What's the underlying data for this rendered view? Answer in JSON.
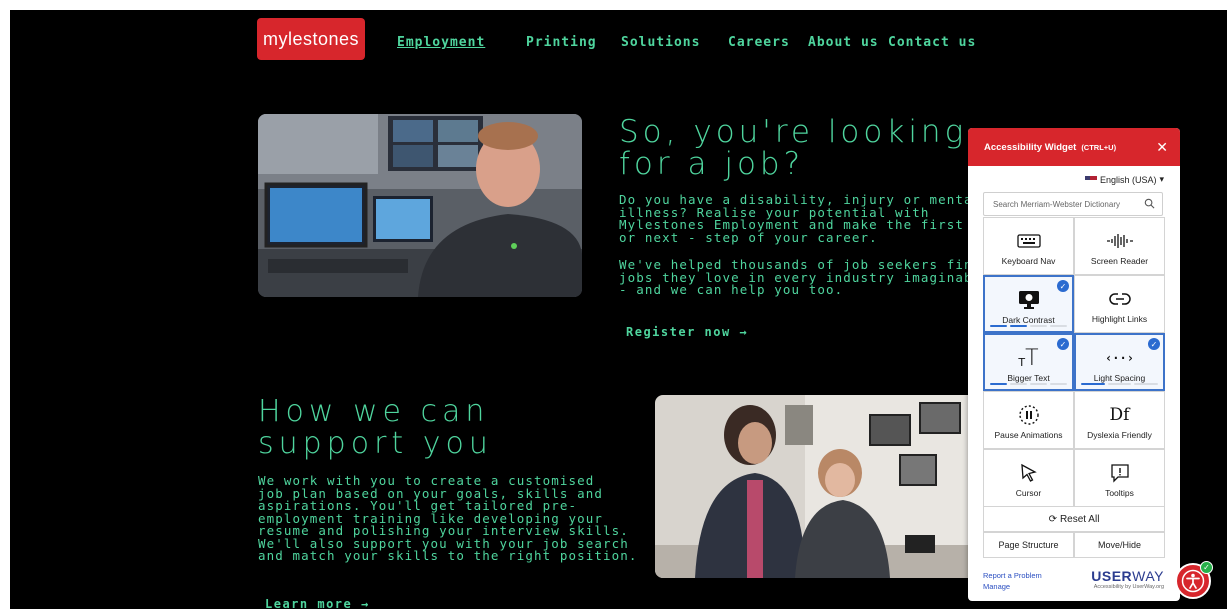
{
  "logo": {
    "text": "mylestones"
  },
  "nav": [
    {
      "label": "Employment",
      "active": true
    },
    {
      "label": "Printing"
    },
    {
      "label": "Solutions"
    },
    {
      "label": "Careers"
    },
    {
      "label": "About us"
    },
    {
      "label": "Contact us"
    }
  ],
  "hero": {
    "title_line1": "So, you're looking",
    "title_line2": "for a job?",
    "para1": [
      "Do you have a disability, injury or mental",
      "illness? Realise your potential with",
      "Mylestones Employment and make the first",
      "or next - step of your career."
    ],
    "para2": [
      "We've helped thousands of job seekers find",
      "jobs they love in every industry imaginable",
      "- and we can help you too."
    ],
    "cta": "Register now →"
  },
  "support": {
    "title_line1": "How we can",
    "title_line2": "support you",
    "para": [
      "We work with you to create a customised",
      "job plan based on your goals, skills and",
      "aspirations. You'll get tailored pre-",
      "employment training like developing your",
      "resume and polishing your interview skills.",
      "We'll also support you with your job search",
      "and match your skills to the right position."
    ],
    "cta": "Learn more →"
  },
  "widget": {
    "title": "Accessibility Widget",
    "shortcut": "(CTRL+U)",
    "close": "✕",
    "language": "English (USA)",
    "search_placeholder": "Search Merriam-Webster Dictionary",
    "tiles": [
      {
        "label": "Keyboard Nav",
        "icon": "keyboard-icon",
        "checked": false
      },
      {
        "label": "Screen Reader",
        "icon": "soundwave-icon",
        "checked": false
      },
      {
        "label": "Dark Contrast",
        "icon": "monitor-icon",
        "checked": true,
        "level": 2,
        "levels": 4
      },
      {
        "label": "Highlight Links",
        "icon": "link-icon",
        "checked": false
      },
      {
        "label": "Bigger Text",
        "icon": "text-size-icon",
        "checked": true,
        "level": 1,
        "levels": 4
      },
      {
        "label": "Light Spacing",
        "icon": "spacing-icon",
        "checked": true,
        "level": 1,
        "levels": 3
      },
      {
        "label": "Pause Animations",
        "icon": "pause-icon",
        "checked": false
      },
      {
        "label": "Dyslexia Friendly",
        "icon": "df-icon",
        "checked": false
      },
      {
        "label": "Cursor",
        "icon": "cursor-icon",
        "checked": false
      },
      {
        "label": "Tooltips",
        "icon": "tooltip-icon",
        "checked": false
      }
    ],
    "reset": "Reset All",
    "page_structure": "Page Structure",
    "move_hide": "Move/Hide",
    "report": "Report a Problem",
    "manage": "Manage",
    "brand_bold": "USER",
    "brand_light": "WAY",
    "brand_sub": "Accessibility by UserWay.org"
  },
  "colors": {
    "accent": "#4fd59e",
    "brand_red": "#d7262c",
    "widget_blue": "#2b6bd0"
  }
}
